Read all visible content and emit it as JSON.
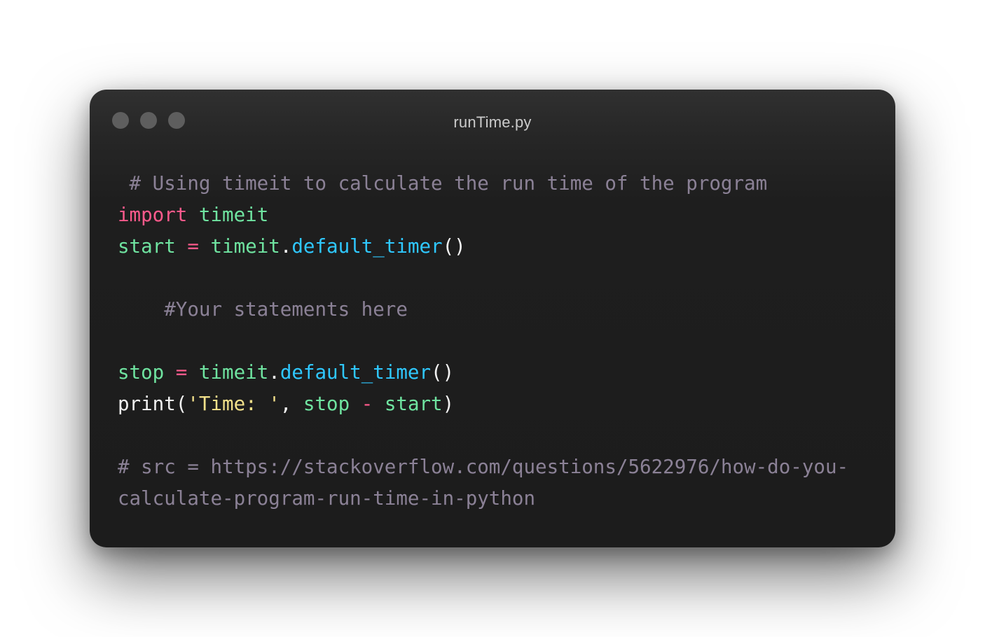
{
  "window": {
    "title": "runTime.py",
    "dot_color": "#5e5e5e",
    "background": "#1c1c1c"
  },
  "code": {
    "line1_comment": " # Using timeit to calculate the run time of the program",
    "line2_kw_import": "import",
    "line2_space": " ",
    "line2_module": "timeit",
    "line3_var": "start",
    "line3_eq": " = ",
    "line3_module": "timeit",
    "line3_dot": ".",
    "line3_fn": "default_timer",
    "line3_parens": "()",
    "line5_comment": "    #Your statements here",
    "line7_var": "stop",
    "line7_eq": " = ",
    "line7_module": "timeit",
    "line7_dot": ".",
    "line7_fn": "default_timer",
    "line7_parens": "()",
    "line8_print": "print(",
    "line8_str": "'Time: '",
    "line8_comma": ", ",
    "line8_stop": "stop",
    "line8_minus": " - ",
    "line8_start": "start",
    "line8_close": ")",
    "line10_comment": "# src = https://stackoverflow.com/questions/5622976/how-do-you-",
    "line11_comment": "calculate-program-run-time-in-python"
  },
  "syntax_colors": {
    "comment": "#8b8196",
    "keyword": "#ff5a8c",
    "identifier": "#6fe3a0",
    "function": "#2fc8ff",
    "string": "#f2e08a",
    "plain": "#f2f2f2"
  }
}
